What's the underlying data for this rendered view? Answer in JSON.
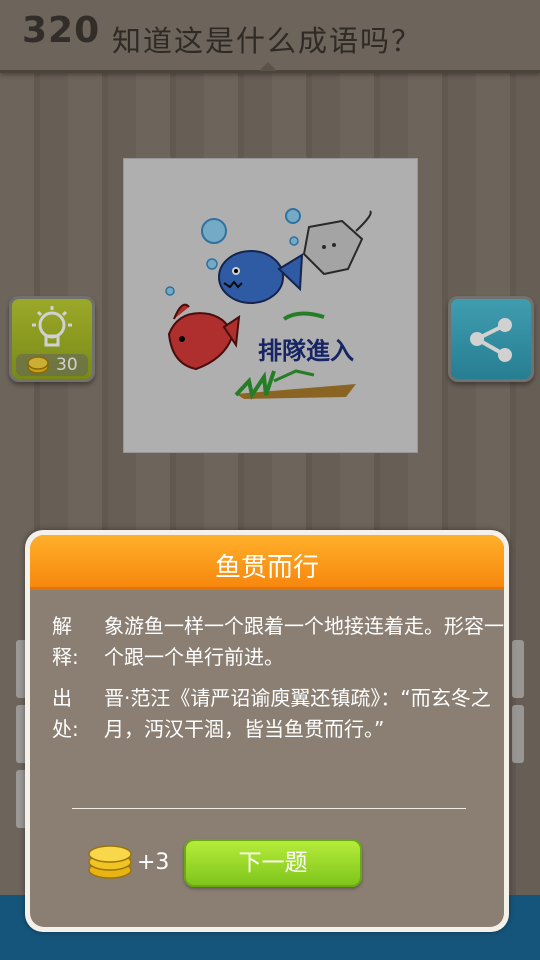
{
  "header": {
    "level": "320",
    "question": "知道这是什么成语吗？"
  },
  "puzzle": {
    "caption": "排隊進入",
    "picture_icons": [
      "fish-icon",
      "pufferfish-icon",
      "stingray-icon",
      "bubble-icon",
      "seaweed-icon"
    ]
  },
  "hint_button": {
    "icon": "lightbulb-icon",
    "cost": "30"
  },
  "share_button": {
    "icon": "share-icon"
  },
  "dialog": {
    "title": "鱼贯而行",
    "explanation_label": "解释:",
    "explanation_text": "象游鱼一样一个跟着一个地接连着走。形容一个跟一个单行前进。",
    "source_label": "出处:",
    "source_text": "晋·范汪《请严诏谕庾翼还镇疏》：“而玄冬之月，沔汉干涸，皆当鱼贯而行。”",
    "reward_text": "+3",
    "next_button": "下一题"
  },
  "colors": {
    "header_orange": "#f7870e",
    "next_green": "#7fc51c",
    "hint_green": "#95a81c",
    "share_blue": "#2f9ab2"
  }
}
